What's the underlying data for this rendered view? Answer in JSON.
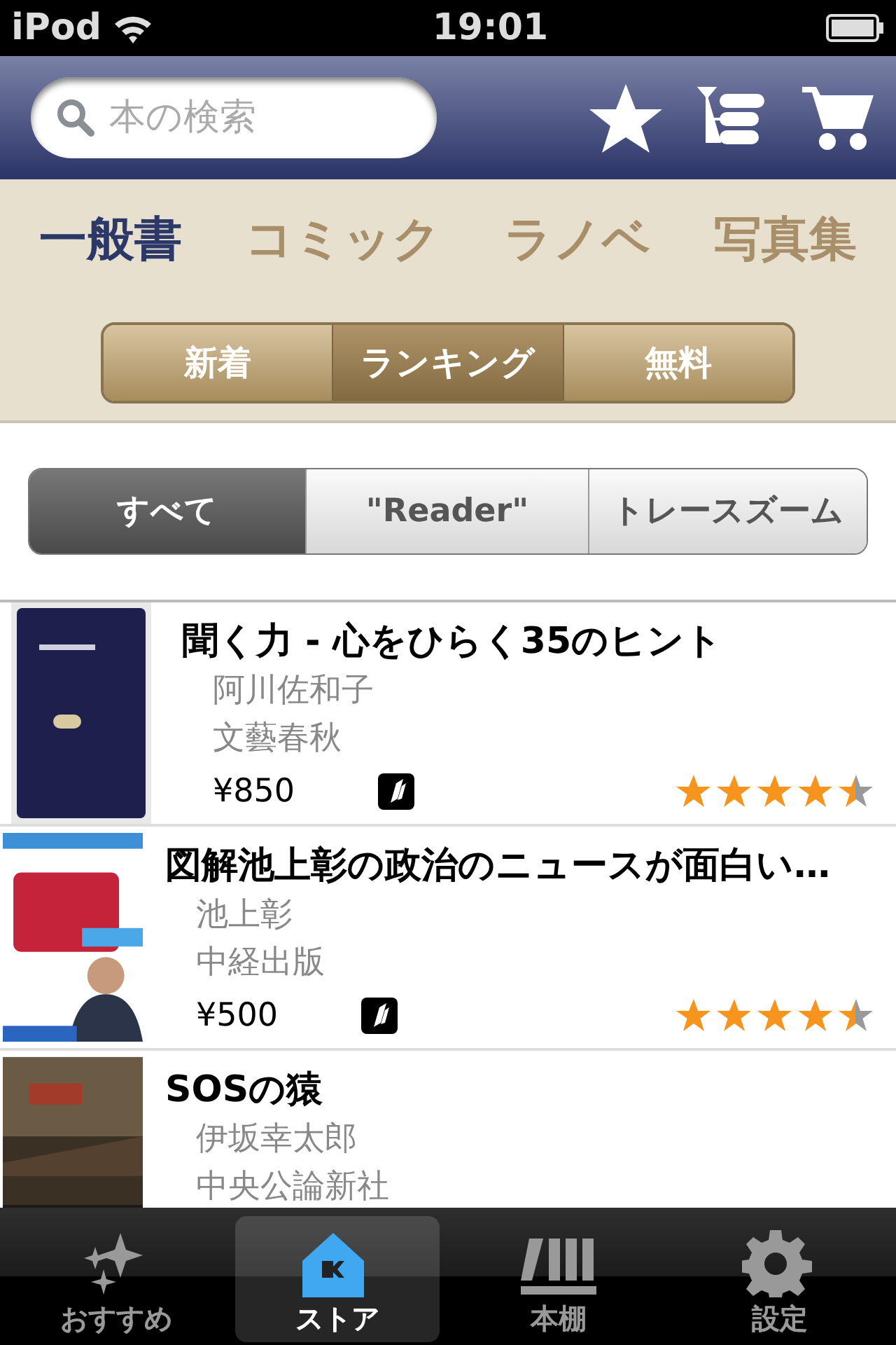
{
  "status_bar": {
    "carrier": "iPod",
    "time": "19:01"
  },
  "search": {
    "placeholder": "本の検索"
  },
  "categories": [
    {
      "label": "一般書",
      "selected": true
    },
    {
      "label": "コミック",
      "selected": false
    },
    {
      "label": "ラノベ",
      "selected": false
    },
    {
      "label": "写真集",
      "selected": false
    }
  ],
  "sort_segments": [
    {
      "label": "新着",
      "selected": false
    },
    {
      "label": "ランキング",
      "selected": true
    },
    {
      "label": "無料",
      "selected": false
    }
  ],
  "filter_segments": [
    {
      "label": "すべて",
      "selected": true
    },
    {
      "label": "\"Reader\"",
      "selected": false
    },
    {
      "label": "トレースズーム",
      "selected": false
    }
  ],
  "books": [
    {
      "title": "聞く力 - 心をひらく35のヒント",
      "author": "阿川佐和子",
      "publisher": "文藝春秋",
      "price": "¥850",
      "stars": 4.5
    },
    {
      "title": "図解池上彰の政治のニュースが面白い…",
      "author": "池上彰",
      "publisher": "中経出版",
      "price": "¥500",
      "stars": 4.5
    },
    {
      "title": "SOSの猿",
      "author": "伊坂幸太郎",
      "publisher": "中央公論新社"
    }
  ],
  "tab_bar": [
    {
      "label": "おすすめ",
      "selected": false
    },
    {
      "label": "ストア",
      "selected": true
    },
    {
      "label": "本棚",
      "selected": false
    },
    {
      "label": "設定",
      "selected": false
    }
  ]
}
